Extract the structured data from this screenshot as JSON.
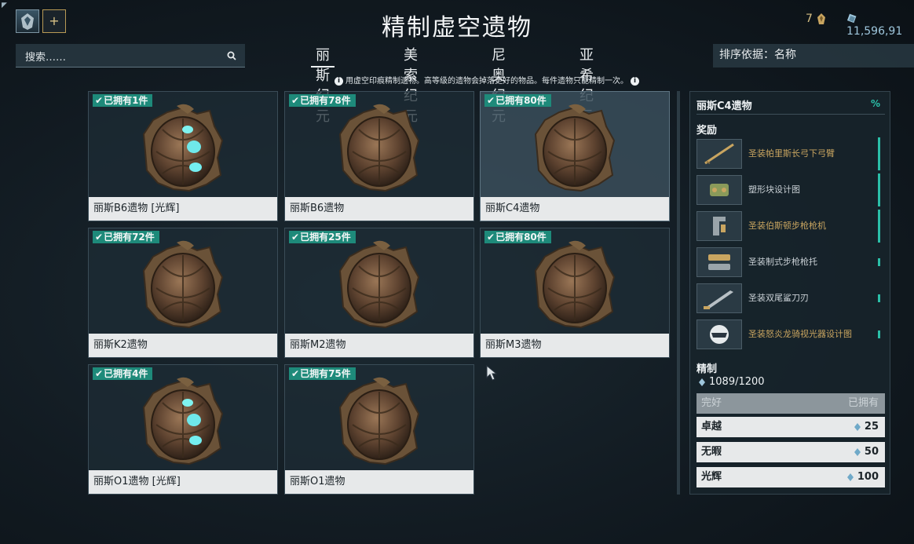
{
  "header": {
    "title": "精制虚空遗物",
    "platinum": "7",
    "credits": "11,596,91"
  },
  "search": {
    "placeholder": "搜索……"
  },
  "tabs": [
    {
      "label": "丽斯纪元",
      "active": true
    },
    {
      "label": "美索纪元",
      "active": false
    },
    {
      "label": "尼奥纪元",
      "active": false
    },
    {
      "label": "亚希纪元",
      "active": false
    }
  ],
  "sort": {
    "label": "排序依据：名称"
  },
  "hint": "用虚空印痕精制遗物。高等级的遗物会掉落更好的物品。每件遗物只能精制一次。",
  "relics": [
    {
      "owned": "已拥有1件",
      "name": "丽斯B6遗物 [光辉]",
      "radiant": true
    },
    {
      "owned": "已拥有78件",
      "name": "丽斯B6遗物",
      "radiant": false
    },
    {
      "owned": "已拥有80件",
      "name": "丽斯C4遗物",
      "radiant": false,
      "selected": true
    },
    {
      "owned": "已拥有72件",
      "name": "丽斯K2遗物",
      "radiant": false
    },
    {
      "owned": "已拥有25件",
      "name": "丽斯M2遗物",
      "radiant": false
    },
    {
      "owned": "已拥有80件",
      "name": "丽斯M3遗物",
      "radiant": false
    },
    {
      "owned": "已拥有4件",
      "name": "丽斯O1遗物 [光辉]",
      "radiant": true
    },
    {
      "owned": "已拥有75件",
      "name": "丽斯O1遗物",
      "radiant": false
    }
  ],
  "panel": {
    "title": "丽斯C4遗物",
    "percent": "%",
    "rewards_label": "奖励",
    "rewards": [
      {
        "name": "圣装帕里斯长弓下弓臂",
        "rarity": "gold",
        "icon": "bow-limb-icon"
      },
      {
        "name": "塑形块设计图",
        "rarity": "silver",
        "icon": "forma-icon"
      },
      {
        "name": "圣装伯斯顿步枪枪机",
        "rarity": "gold",
        "icon": "receiver-icon"
      },
      {
        "name": "圣装制式步枪枪托",
        "rarity": "silver",
        "icon": "stock-icon"
      },
      {
        "name": "圣装双尾鲨刀刃",
        "rarity": "silver",
        "icon": "blade-icon"
      },
      {
        "name": "圣装怒炎龙骑视光器设计图",
        "rarity": "gold",
        "icon": "helmet-icon"
      }
    ],
    "refine_label": "精制",
    "traces": "1089/1200",
    "refinements": [
      {
        "label": "完好",
        "value": "已拥有",
        "disabled": true
      },
      {
        "label": "卓越",
        "value": "25",
        "disabled": false
      },
      {
        "label": "无暇",
        "value": "50",
        "disabled": false
      },
      {
        "label": "光辉",
        "value": "100",
        "disabled": false
      }
    ]
  },
  "colors": {
    "badge": "#1e8a7a",
    "accent_teal": "#2bbfa8",
    "gold_reward": "#c9a560"
  }
}
